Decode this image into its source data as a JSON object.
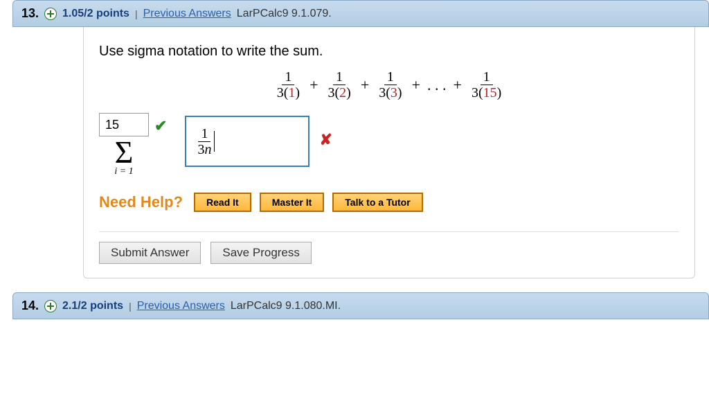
{
  "q13": {
    "number": "13.",
    "points": "1.05/2 points",
    "divider": "|",
    "prev_answers": "Previous Answers",
    "textbook": "LarPCalc9 9.1.079.",
    "prompt": "Use sigma notation to write the sum.",
    "sum": {
      "num": "1",
      "den_tpl_a": "3(",
      "den_tpl_b": ")",
      "terms": [
        "1",
        "2",
        "3"
      ],
      "dots": ". . .",
      "last": "15",
      "plus": "+"
    },
    "sigma": {
      "upper": "15",
      "sigma": "Σ",
      "lower": "i = 1",
      "expr_num": "1",
      "expr_den_a": "3",
      "expr_den_b": "n"
    },
    "marks": {
      "check": "✔",
      "x": "✘"
    },
    "help": {
      "label": "Need Help?",
      "read": "Read It",
      "master": "Master It",
      "tutor": "Talk to a Tutor"
    },
    "actions": {
      "submit": "Submit Answer",
      "save": "Save Progress"
    }
  },
  "q14": {
    "number": "14.",
    "points": "2.1/2 points",
    "divider": "|",
    "prev_answers": "Previous Answers",
    "textbook": "LarPCalc9 9.1.080.MI."
  }
}
